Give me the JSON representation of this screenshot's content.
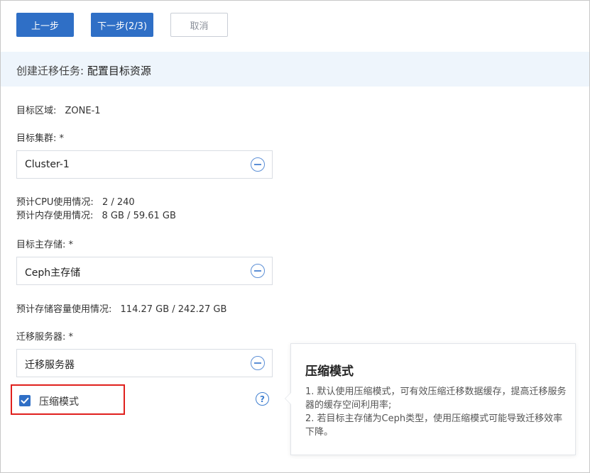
{
  "toolbar": {
    "prev_label": "上一步",
    "next_label": "下一步(2/3)",
    "cancel_label": "取消"
  },
  "header": {
    "title_prefix": "创建迁移任务: ",
    "title_main": "配置目标资源"
  },
  "form": {
    "zone": {
      "label": "目标区域:",
      "value": "ZONE-1"
    },
    "cluster": {
      "label": "目标集群: *",
      "value": "Cluster-1",
      "icon": "minus-circle-icon"
    },
    "cpu_usage": {
      "label": "预计CPU使用情况:",
      "value": "2 / 240"
    },
    "mem_usage": {
      "label": "预计内存使用情况:",
      "value": "8 GB / 59.61 GB"
    },
    "primary_storage": {
      "label": "目标主存储: *",
      "value": "Ceph主存储",
      "icon": "minus-circle-icon"
    },
    "storage_usage": {
      "label": "预计存储容量使用情况:",
      "value": "114.27 GB / 242.27 GB"
    },
    "migration_server": {
      "label": "迁移服务器: *",
      "value": "迁移服务器",
      "icon": "minus-circle-icon"
    },
    "compression": {
      "label": "压缩模式",
      "checked": true,
      "help_icon": "question-circle-icon",
      "help_symbol": "?"
    }
  },
  "tooltip": {
    "title": "压缩模式",
    "line1": "1. 默认使用压缩模式，可有效压缩迁移数据缓存，提高迁移服务器的缓存空间利用率;",
    "line2": "2. 若目标主存储为Ceph类型，使用压缩模式可能导致迁移效率下降。"
  },
  "colors": {
    "primary": "#2f6fc6",
    "header_bg": "#eef5fc",
    "highlight_border": "#e0201d"
  }
}
